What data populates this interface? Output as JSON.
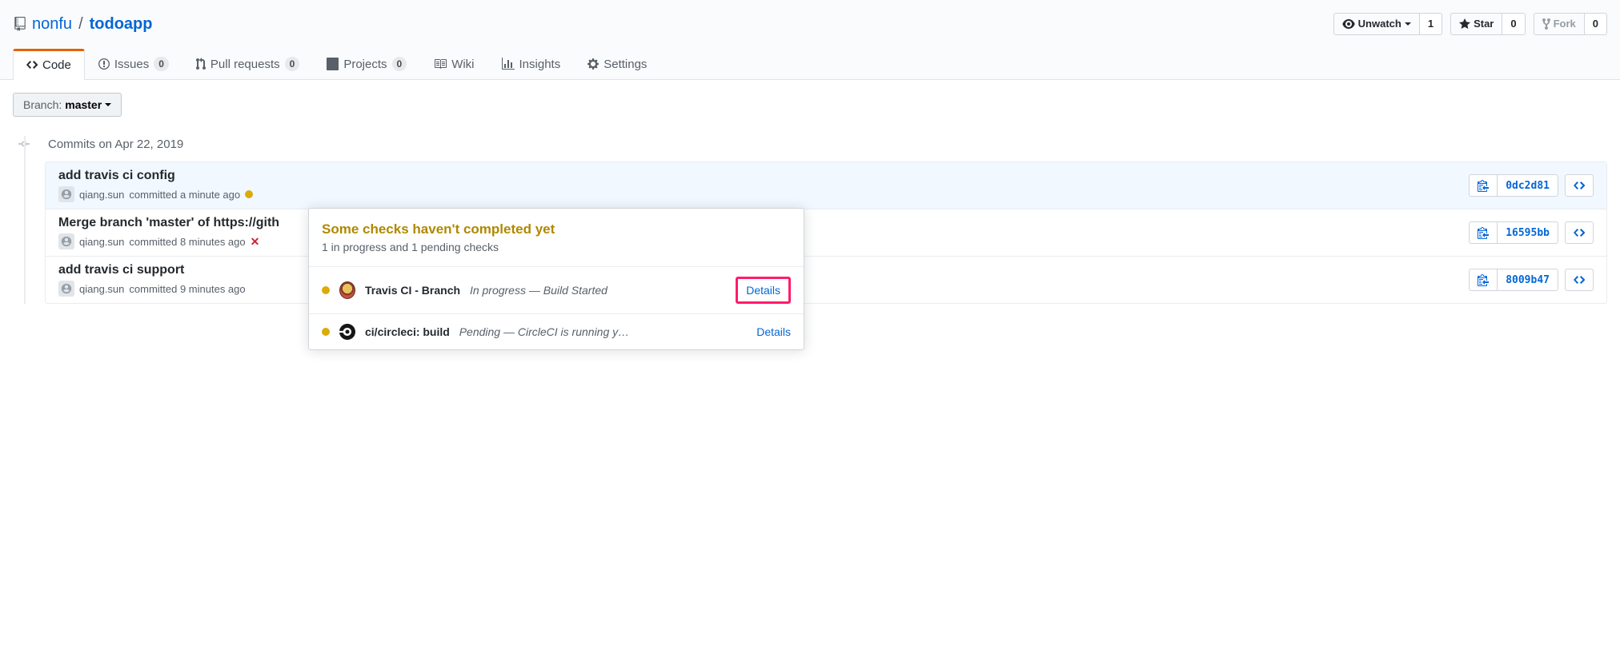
{
  "repo": {
    "owner": "nonfu",
    "name": "todoapp"
  },
  "actions": {
    "watch": {
      "label": "Unwatch",
      "count": "1"
    },
    "star": {
      "label": "Star",
      "count": "0"
    },
    "fork": {
      "label": "Fork",
      "count": "0"
    }
  },
  "nav": {
    "code": "Code",
    "issues": {
      "label": "Issues",
      "count": "0"
    },
    "pulls": {
      "label": "Pull requests",
      "count": "0"
    },
    "projects": {
      "label": "Projects",
      "count": "0"
    },
    "wiki": "Wiki",
    "insights": "Insights",
    "settings": "Settings"
  },
  "branch": {
    "label": "Branch:",
    "name": "master"
  },
  "commits_date": "Commits on Apr 22, 2019",
  "commits": [
    {
      "title": "add travis ci config",
      "author": "qiang.sun",
      "time": "committed a minute ago",
      "sha": "0dc2d81",
      "status": "pending"
    },
    {
      "title": "Merge branch 'master' of https://gith",
      "author": "qiang.sun",
      "time": "committed 8 minutes ago",
      "sha": "16595bb",
      "status": "fail"
    },
    {
      "title": "add travis ci support",
      "author": "qiang.sun",
      "time": "committed 9 minutes ago",
      "sha": "8009b47",
      "status": "none"
    }
  ],
  "popover": {
    "title": "Some checks haven't completed yet",
    "subtitle": "1 in progress and 1 pending checks",
    "checks": [
      {
        "name": "Travis CI - Branch",
        "status": "In progress — Build Started",
        "details": "Details"
      },
      {
        "name": "ci/circleci: build",
        "status": "Pending — CircleCI is running y…",
        "details": "Details"
      }
    ]
  }
}
